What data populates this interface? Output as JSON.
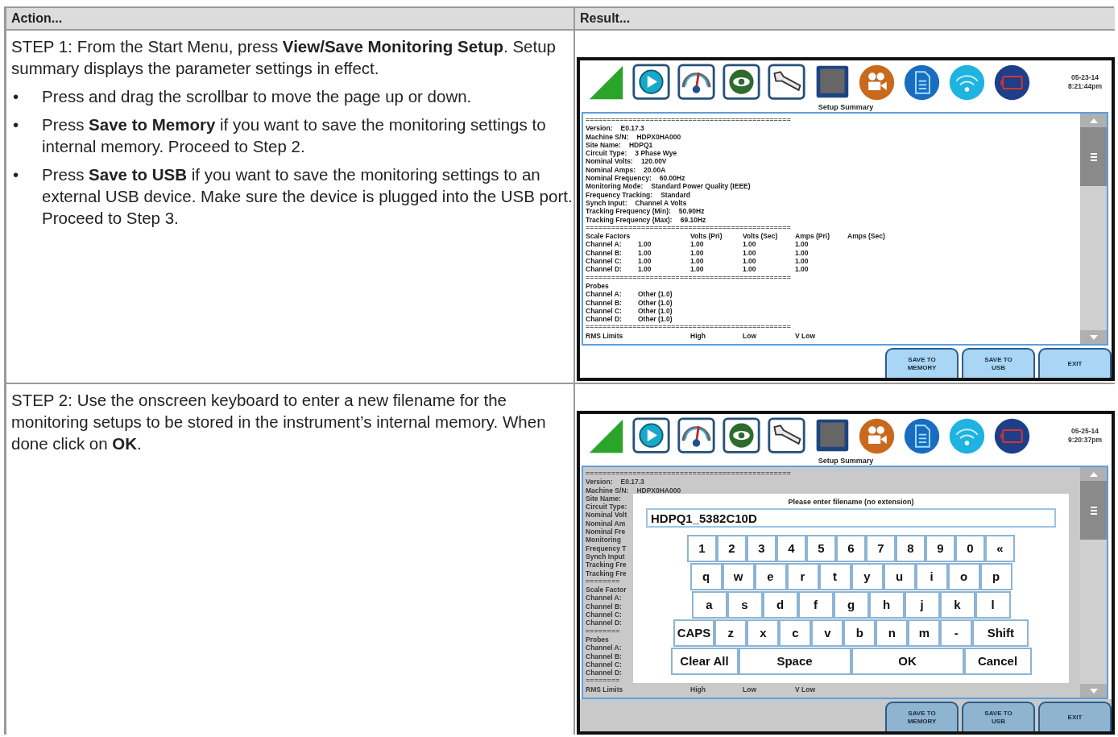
{
  "table": {
    "columns": [
      "Action...",
      "Result..."
    ],
    "rows": [
      {
        "action": {
          "lead": "STEP 1: From the Start Menu, press **View/Save Monitoring Setup**. Setup summary displays the parameter settings in effect.",
          "bullets": [
            {
              "marker": "•",
              "text": "Press and drag the scrollbar to move the page up or down."
            },
            {
              "marker": "•",
              "text": "Press **Save to Memory** if you want to save the monitoring settings to internal memory. Proceed to Step 2."
            },
            {
              "marker": "•",
              "text": "Press **Save to USB** if you want to save the monitoring settings to an external USB device. Make sure the device is plugged into the USB port. Proceed to Step 3."
            }
          ]
        },
        "result": {
          "date": "05-23-14",
          "time": "8:21:44pm",
          "title": "Setup Summary",
          "dimmed": false,
          "lines": [
            {
              "kind": "rule",
              "cells": [
                "================================================"
              ]
            },
            {
              "kind": "kv",
              "cells": [
                "Version:",
                "E0.17.3"
              ]
            },
            {
              "kind": "kv",
              "cells": [
                "Machine S/N:",
                "HDPX0HA000"
              ]
            },
            {
              "kind": "kv",
              "cells": [
                "Site Name:",
                "HDPQ1"
              ]
            },
            {
              "kind": "kv",
              "cells": [
                "Circuit Type:",
                "3 Phase Wye"
              ]
            },
            {
              "kind": "kv",
              "cells": [
                "Nominal Volts:",
                "120.00V"
              ]
            },
            {
              "kind": "kv",
              "cells": [
                "Nominal Amps:",
                "20.00A"
              ]
            },
            {
              "kind": "kv",
              "cells": [
                "Nominal Frequency:",
                "60.00Hz"
              ]
            },
            {
              "kind": "kv",
              "cells": [
                "Monitoring Mode:",
                "Standard Power Quality (IEEE)"
              ]
            },
            {
              "kind": "kv",
              "cells": [
                "Frequency Tracking:",
                "Standard"
              ]
            },
            {
              "kind": "kv",
              "cells": [
                "Synch Input:",
                "Channel A Volts"
              ]
            },
            {
              "kind": "kv",
              "cells": [
                "Tracking Frequency (Min):",
                "50.90Hz"
              ]
            },
            {
              "kind": "kv",
              "cells": [
                "Tracking Frequency (Max):",
                "69.10Hz"
              ]
            },
            {
              "kind": "rule",
              "cells": [
                "================================================"
              ]
            },
            {
              "kind": "header",
              "cells": [
                "Scale Factors",
                "Volts (Pri)",
                "Volts (Sec)",
                "Amps (Pri)",
                "Amps (Sec)"
              ]
            },
            {
              "kind": "grid",
              "cells": [
                "Channel A:",
                "1.00",
                "1.00",
                "1.00",
                "1.00"
              ]
            },
            {
              "kind": "grid",
              "cells": [
                "Channel B:",
                "1.00",
                "1.00",
                "1.00",
                "1.00"
              ]
            },
            {
              "kind": "grid",
              "cells": [
                "Channel C:",
                "1.00",
                "1.00",
                "1.00",
                "1.00"
              ]
            },
            {
              "kind": "grid",
              "cells": [
                "Channel D:",
                "1.00",
                "1.00",
                "1.00",
                "1.00"
              ]
            },
            {
              "kind": "rule",
              "cells": [
                "================================================"
              ]
            },
            {
              "kind": "text",
              "cells": [
                "Probes"
              ]
            },
            {
              "kind": "grid",
              "cells": [
                "Channel A:",
                "Other (1.0)"
              ]
            },
            {
              "kind": "grid",
              "cells": [
                "Channel B:",
                "Other (1.0)"
              ]
            },
            {
              "kind": "grid",
              "cells": [
                "Channel C:",
                "Other (1.0)"
              ]
            },
            {
              "kind": "grid",
              "cells": [
                "Channel D:",
                "Other (1.0)"
              ]
            },
            {
              "kind": "rule",
              "cells": [
                "================================================"
              ]
            },
            {
              "kind": "header",
              "cells": [
                "RMS Limits",
                "High",
                "Low",
                "V Low"
              ]
            }
          ],
          "buttons": [
            "SAVE TO MEMORY",
            "SAVE TO USB",
            "EXIT"
          ]
        }
      },
      {
        "action": {
          "lead": "STEP 2: Use the onscreen keyboard to enter a new filename for the monitoring setups to be stored in the instrument’s internal memory. When done click on **OK**."
        },
        "result": {
          "date": "05-25-14",
          "time": "9:20:37pm",
          "title": "Setup Summary",
          "dimmed": true,
          "lines": [
            {
              "kind": "rule",
              "cells": [
                "================================================"
              ]
            },
            {
              "kind": "kv",
              "cells": [
                "Version:",
                "E0.17.3"
              ]
            },
            {
              "kind": "kv",
              "cells": [
                "Machine S/N:",
                "HDPX0HA000"
              ]
            },
            {
              "kind": "text",
              "cells": [
                "Site Name:"
              ]
            },
            {
              "kind": "text",
              "cells": [
                "Circuit Type:"
              ]
            },
            {
              "kind": "text",
              "cells": [
                "Nominal Volt"
              ]
            },
            {
              "kind": "text",
              "cells": [
                "Nominal Am"
              ]
            },
            {
              "kind": "text",
              "cells": [
                "Nominal Fre"
              ]
            },
            {
              "kind": "text",
              "cells": [
                "Monitoring"
              ]
            },
            {
              "kind": "text",
              "cells": [
                "Frequency T"
              ]
            },
            {
              "kind": "text",
              "cells": [
                "Synch Input"
              ]
            },
            {
              "kind": "text",
              "cells": [
                "Tracking Fre"
              ]
            },
            {
              "kind": "text",
              "cells": [
                "Tracking Fre"
              ]
            },
            {
              "kind": "rule",
              "cells": [
                "========"
              ]
            },
            {
              "kind": "text",
              "cells": [
                "Scale Factor"
              ]
            },
            {
              "kind": "text",
              "cells": [
                "Channel A:"
              ]
            },
            {
              "kind": "text",
              "cells": [
                "Channel B:"
              ]
            },
            {
              "kind": "text",
              "cells": [
                "Channel C:"
              ]
            },
            {
              "kind": "text",
              "cells": [
                "Channel D:"
              ]
            },
            {
              "kind": "rule",
              "cells": [
                "========"
              ]
            },
            {
              "kind": "text",
              "cells": [
                "Probes"
              ]
            },
            {
              "kind": "text",
              "cells": [
                "Channel A:"
              ]
            },
            {
              "kind": "text",
              "cells": [
                "Channel B:"
              ]
            },
            {
              "kind": "text",
              "cells": [
                "Channel C:"
              ]
            },
            {
              "kind": "text",
              "cells": [
                "Channel D:"
              ]
            },
            {
              "kind": "rule",
              "cells": [
                "========"
              ]
            },
            {
              "kind": "header",
              "cells": [
                "RMS Limits",
                "High",
                "Low",
                "V Low"
              ]
            }
          ],
          "dialog": {
            "prompt": "Please enter filename (no extension)",
            "value": "HDPQ1_5382C10D",
            "keys": [
              [
                {
                  "kind": "char",
                  "label": "1"
                },
                {
                  "kind": "char",
                  "label": "2"
                },
                {
                  "kind": "char",
                  "label": "3"
                },
                {
                  "kind": "char",
                  "label": "4"
                },
                {
                  "kind": "char",
                  "label": "5"
                },
                {
                  "kind": "char",
                  "label": "6"
                },
                {
                  "kind": "char",
                  "label": "7"
                },
                {
                  "kind": "char",
                  "label": "8"
                },
                {
                  "kind": "char",
                  "label": "9"
                },
                {
                  "kind": "char",
                  "label": "0"
                },
                {
                  "kind": "char",
                  "label": "«"
                }
              ],
              [
                {
                  "kind": "char",
                  "label": "q"
                },
                {
                  "kind": "char",
                  "label": "w"
                },
                {
                  "kind": "char",
                  "label": "e"
                },
                {
                  "kind": "char",
                  "label": "r"
                },
                {
                  "kind": "char",
                  "label": "t"
                },
                {
                  "kind": "char",
                  "label": "y"
                },
                {
                  "kind": "char",
                  "label": "u"
                },
                {
                  "kind": "char",
                  "label": "i"
                },
                {
                  "kind": "char",
                  "label": "o"
                },
                {
                  "kind": "char",
                  "label": "p"
                }
              ],
              [
                {
                  "kind": "char",
                  "label": "a"
                },
                {
                  "kind": "char",
                  "label": "s"
                },
                {
                  "kind": "char",
                  "label": "d"
                },
                {
                  "kind": "char",
                  "label": "f"
                },
                {
                  "kind": "char",
                  "label": "g"
                },
                {
                  "kind": "char",
                  "label": "h"
                },
                {
                  "kind": "char",
                  "label": "j"
                },
                {
                  "kind": "char",
                  "label": "k"
                },
                {
                  "kind": "char",
                  "label": "l"
                }
              ],
              [
                {
                  "kind": "char",
                  "label": "CAPS"
                },
                {
                  "kind": "char",
                  "label": "z"
                },
                {
                  "kind": "char",
                  "label": "x"
                },
                {
                  "kind": "char",
                  "label": "c"
                },
                {
                  "kind": "char",
                  "label": "v"
                },
                {
                  "kind": "char",
                  "label": "b"
                },
                {
                  "kind": "char",
                  "label": "n"
                },
                {
                  "kind": "char",
                  "label": "m"
                },
                {
                  "kind": "char",
                  "label": "-"
                },
                {
                  "kind": "wide",
                  "label": "Shift"
                }
              ],
              [
                {
                  "kind": "wide",
                  "label": "Clear All"
                },
                {
                  "kind": "wider",
                  "label": "Space"
                },
                {
                  "kind": "wider",
                  "label": "OK"
                },
                {
                  "kind": "wide",
                  "label": "Cancel"
                }
              ]
            ]
          },
          "buttons": [
            "SAVE TO MEMORY",
            "SAVE TO USB",
            "EXIT"
          ]
        }
      }
    ]
  }
}
